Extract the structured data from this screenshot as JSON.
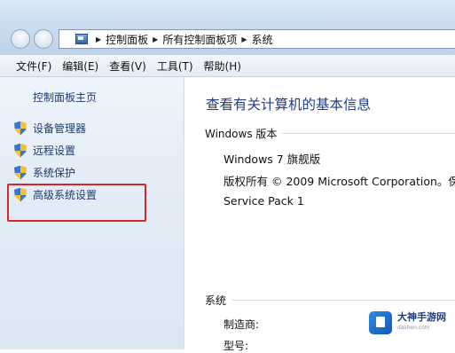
{
  "address_bar": {
    "crumbs": [
      "控制面板",
      "所有控制面板项",
      "系统"
    ]
  },
  "menubar": {
    "items": [
      "文件(F)",
      "编辑(E)",
      "查看(V)",
      "工具(T)",
      "帮助(H)"
    ]
  },
  "sidebar": {
    "home_link": "控制面板主页",
    "tasks": [
      "设备管理器",
      "远程设置",
      "系统保护",
      "高级系统设置"
    ]
  },
  "main": {
    "title": "查看有关计算机的基本信息",
    "windows_edition": {
      "header": "Windows 版本",
      "edition": "Windows 7 旗舰版",
      "copyright": "版权所有 © 2009 Microsoft Corporation。保",
      "service_pack": "Service Pack 1"
    },
    "system": {
      "header": "系统",
      "manufacturer_label": "制造商:",
      "model_label": "型号:"
    }
  },
  "watermark": {
    "name": "大神手游网",
    "url": "dashen.com"
  },
  "colors": {
    "highlight_border": "#d7262a",
    "title_text": "#1e3c8a",
    "link_text": "#1e3b6e"
  }
}
